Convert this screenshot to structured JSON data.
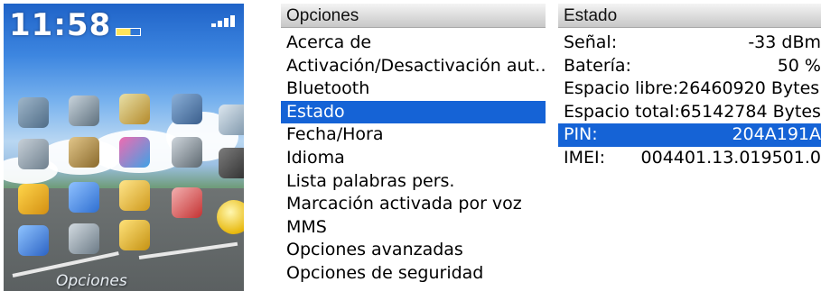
{
  "home": {
    "clock": "11:58",
    "label": "Opciones"
  },
  "options": {
    "title": "Opciones",
    "items": [
      "Acerca de",
      "Activación/Desactivación aut…",
      "Bluetooth",
      "Estado",
      "Fecha/Hora",
      "Idioma",
      "Lista palabras pers.",
      "Marcación activada por voz",
      "MMS",
      "Opciones avanzadas",
      "Opciones de seguridad"
    ],
    "selected_index": 3
  },
  "estado": {
    "title": "Estado",
    "rows": [
      {
        "label": "Señal:",
        "value": "-33 dBm"
      },
      {
        "label": "Batería:",
        "value": "50 %"
      },
      {
        "label": "Espacio libre:",
        "value": "26460920 Bytes"
      },
      {
        "label": "Espacio total:",
        "value": "65142784 Bytes"
      },
      {
        "label": "PIN:",
        "value": "204A191A"
      },
      {
        "label": "IMEI:",
        "value": "004401.13.019501.0"
      }
    ],
    "selected_index": 4
  },
  "colors": {
    "selection": "#1563d6",
    "title_bar": "#d9d9d9"
  }
}
